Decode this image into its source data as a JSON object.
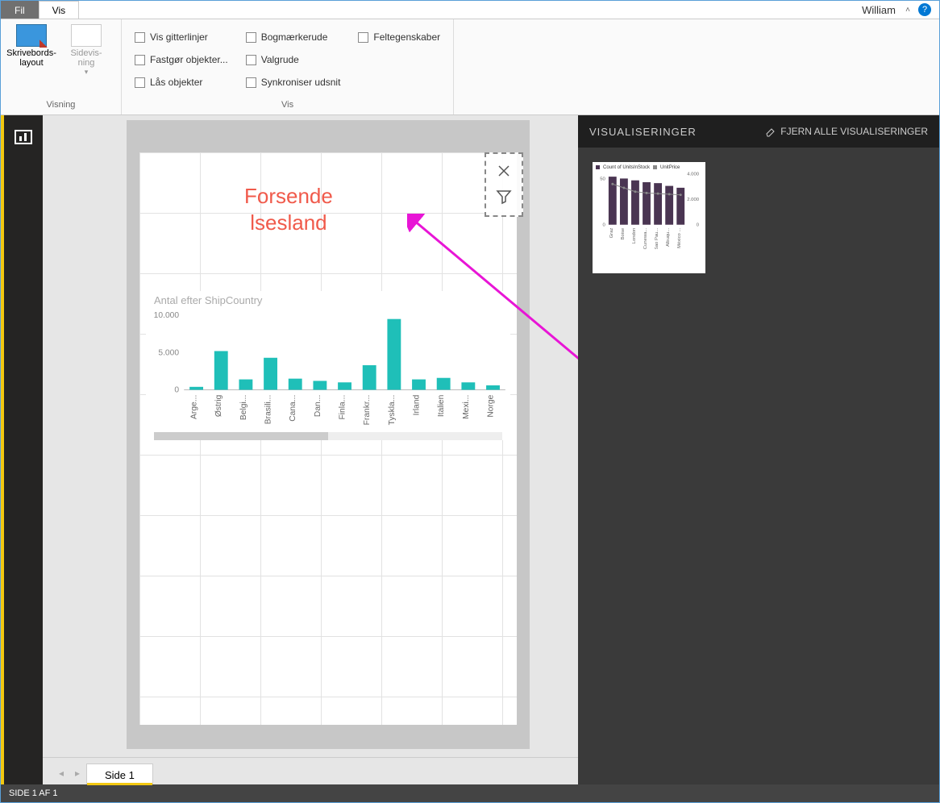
{
  "titlebar": {
    "tab_fil": "Fil",
    "tab_vis": "Vis",
    "username": "William"
  },
  "ribbon": {
    "group_view_label": "Visning",
    "group_vis_label": "Vis",
    "btn_skrive": "Skrivebords-\nlayout",
    "btn_side": "Sidevis-\nning",
    "checks": {
      "gitter": "Vis gitterlinjer",
      "bogmaerke": "Bogmærkerude",
      "felt": "Feltegenskaber",
      "fastgor": "Fastgør objekter...",
      "valgrude": "Valgrude",
      "las": "Lås objekter",
      "synk": "Synkroniser udsnit"
    }
  },
  "canvas": {
    "annot_title": "Forsende­lsesland",
    "annot_line1": "Forsende",
    "annot_line2": "lsesland"
  },
  "chart_data": {
    "type": "bar",
    "title": "Antal efter ShipCountry",
    "ylabel": "",
    "ylim": [
      0,
      10000
    ],
    "yticks": [
      0,
      5000,
      10000
    ],
    "ytick_labels": [
      "0",
      "5.000",
      "10.000"
    ],
    "categories": [
      "Arge...",
      "Østrig",
      "Belgi...",
      "Brasili...",
      "Cana...",
      "Dan...",
      "Finla...",
      "Frankr...",
      "Tyskla...",
      "Irland",
      "Italien",
      "Mexi...",
      "Norge"
    ],
    "values": [
      400,
      5200,
      1400,
      4300,
      1500,
      1200,
      1000,
      3300,
      9500,
      1400,
      1600,
      1000,
      600
    ]
  },
  "vis_panel": {
    "title": "VISUALISERINGER",
    "clear": "FJERN ALLE VISUALISERINGER",
    "thumb": {
      "legend1": "Count of UnitsInStock",
      "legend2": "UnitPrice",
      "left_ticks": [
        "50",
        "0"
      ],
      "right_ticks": [
        "4.000",
        "2.000",
        "0"
      ],
      "categories": [
        "Graz",
        "Boise",
        "London",
        "Cunewa...",
        "Sao Pau...",
        "Albuqu...",
        "México ..."
      ],
      "bars": [
        52,
        50,
        48,
        46,
        45,
        42,
        40
      ],
      "line": [
        3200,
        2900,
        2600,
        2500,
        2450,
        2400,
        2350
      ]
    }
  },
  "tabs": {
    "page1": "Side 1"
  },
  "statusbar": {
    "text": "SIDE 1 AF 1"
  }
}
